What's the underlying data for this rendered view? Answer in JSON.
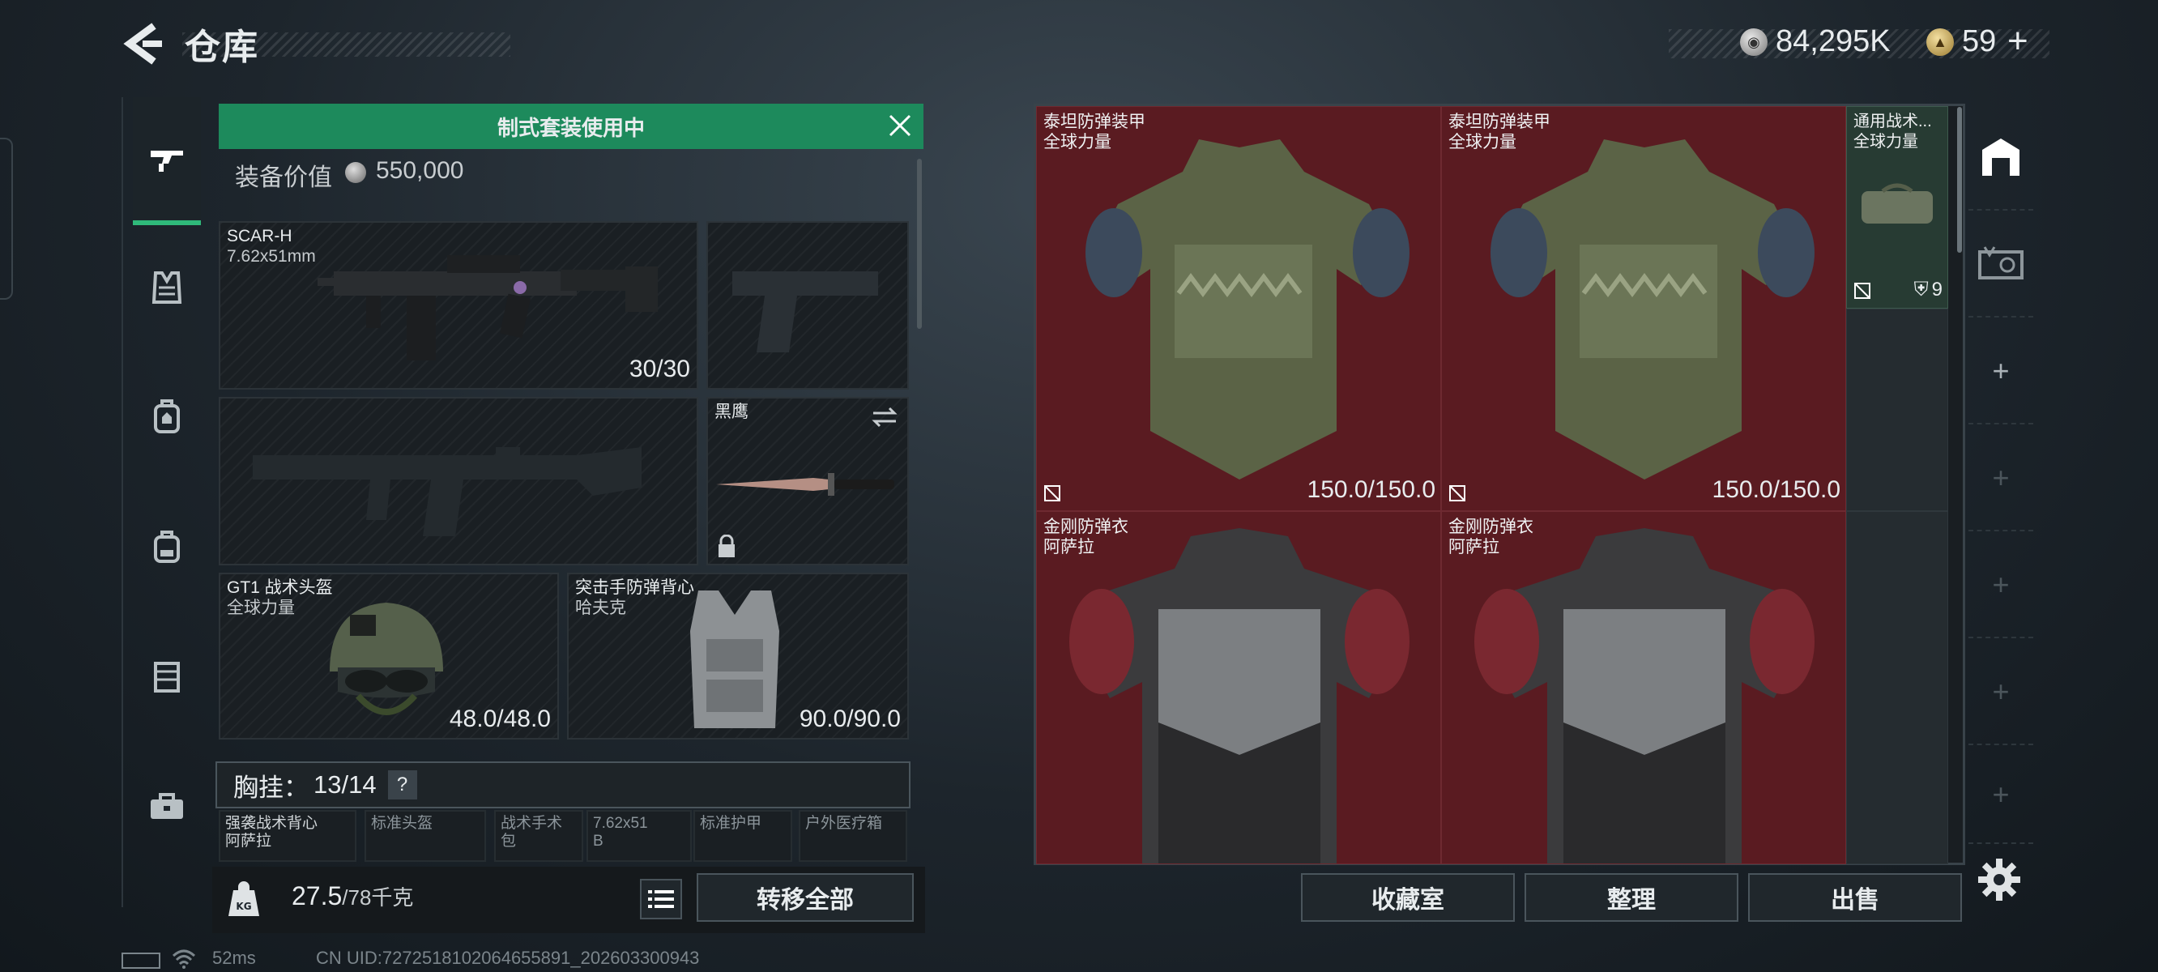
{
  "header": {
    "title": "仓库",
    "currency_silver": "84,295K",
    "currency_gold": "59",
    "gold_add": "+"
  },
  "left_rail": {
    "tabs": [
      "weapon-icon",
      "vest-icon",
      "backpack-armor-icon",
      "backpack-icon",
      "container-icon",
      "toolbox-icon"
    ],
    "active_index": 0
  },
  "loadout": {
    "banner": "制式套装使用中",
    "equip_value_label": "装备价值",
    "equip_value": "550,000",
    "primary_weapon": {
      "name": "SCAR-H",
      "caliber": "7.62x51mm",
      "ammo": "30/30"
    },
    "melee": {
      "name": "黑鹰"
    },
    "helmet": {
      "name": "GT1 战术头盔",
      "brand": "全球力量",
      "durability": "48.0/48.0"
    },
    "armor": {
      "name": "突击手防弹背心",
      "brand": "哈夫克",
      "durability": "90.0/90.0"
    },
    "chest_rig": {
      "label": "胸挂：",
      "count": "13/14",
      "help": "?"
    },
    "mini_slots": [
      {
        "line1": "强袭战术背心",
        "line2": "阿萨拉"
      },
      {
        "line1": "标准头盔",
        "line2": ""
      },
      {
        "line1": "战术手术包",
        "line2": ""
      },
      {
        "line1": "7.62x51",
        "line2": "B"
      },
      {
        "line1": "标准护甲",
        "line2": ""
      },
      {
        "line1": "户外医疗箱",
        "line2": ""
      }
    ],
    "weight": "27.5",
    "weight_max": "/78千克",
    "weight_icon_text": "KG",
    "transfer_all": "转移全部"
  },
  "warehouse": {
    "items": [
      {
        "name": "泰坦防弹装甲",
        "brand": "全球力量",
        "durability": "150.0/150.0"
      },
      {
        "name": "泰坦防弹装甲",
        "brand": "全球力量",
        "durability": "150.0/150.0"
      },
      {
        "name": "通用战术...",
        "brand": "全球力量",
        "count": "9"
      },
      {
        "name": "金刚防弹衣",
        "brand": "阿萨拉"
      },
      {
        "name": "金刚防弹衣",
        "brand": "阿萨拉"
      }
    ],
    "buttons": {
      "collect": "收藏室",
      "sort": "整理",
      "sell": "出售"
    }
  },
  "right_rail": {
    "items": [
      "warehouse-icon",
      "vault-icon",
      "+",
      "+",
      "+",
      "+",
      "+"
    ]
  },
  "status": {
    "ping": "52ms",
    "uid": "CN UID:7272518102064655891_202603300943"
  }
}
